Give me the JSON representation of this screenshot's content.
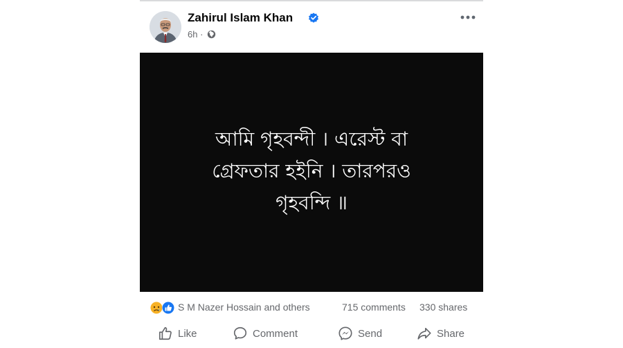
{
  "post": {
    "author": "Zahirul Islam Khan",
    "time": "6h",
    "separator": "·",
    "media_lines": [
      "আমি গৃহবন্দী । এরেস্ট বা",
      "গ্রেফতার হইনি । তারপরও",
      "গৃহবন্দি ॥"
    ],
    "reactions_label": "S M Nazer Hossain and others",
    "comments": "715 comments",
    "shares": "330 shares"
  },
  "actions": {
    "like": "Like",
    "comment": "Comment",
    "send": "Send",
    "share": "Share"
  },
  "icons": {
    "verified": "verified-badge-icon",
    "privacy": "globe-icon",
    "more": "more-options-icon",
    "reaction_sad": "sad-reaction-icon",
    "reaction_like": "like-reaction-icon"
  },
  "colors": {
    "verified_blue": "#1877f2",
    "media_background": "#0b0b0b",
    "secondary_text": "#65676b"
  }
}
